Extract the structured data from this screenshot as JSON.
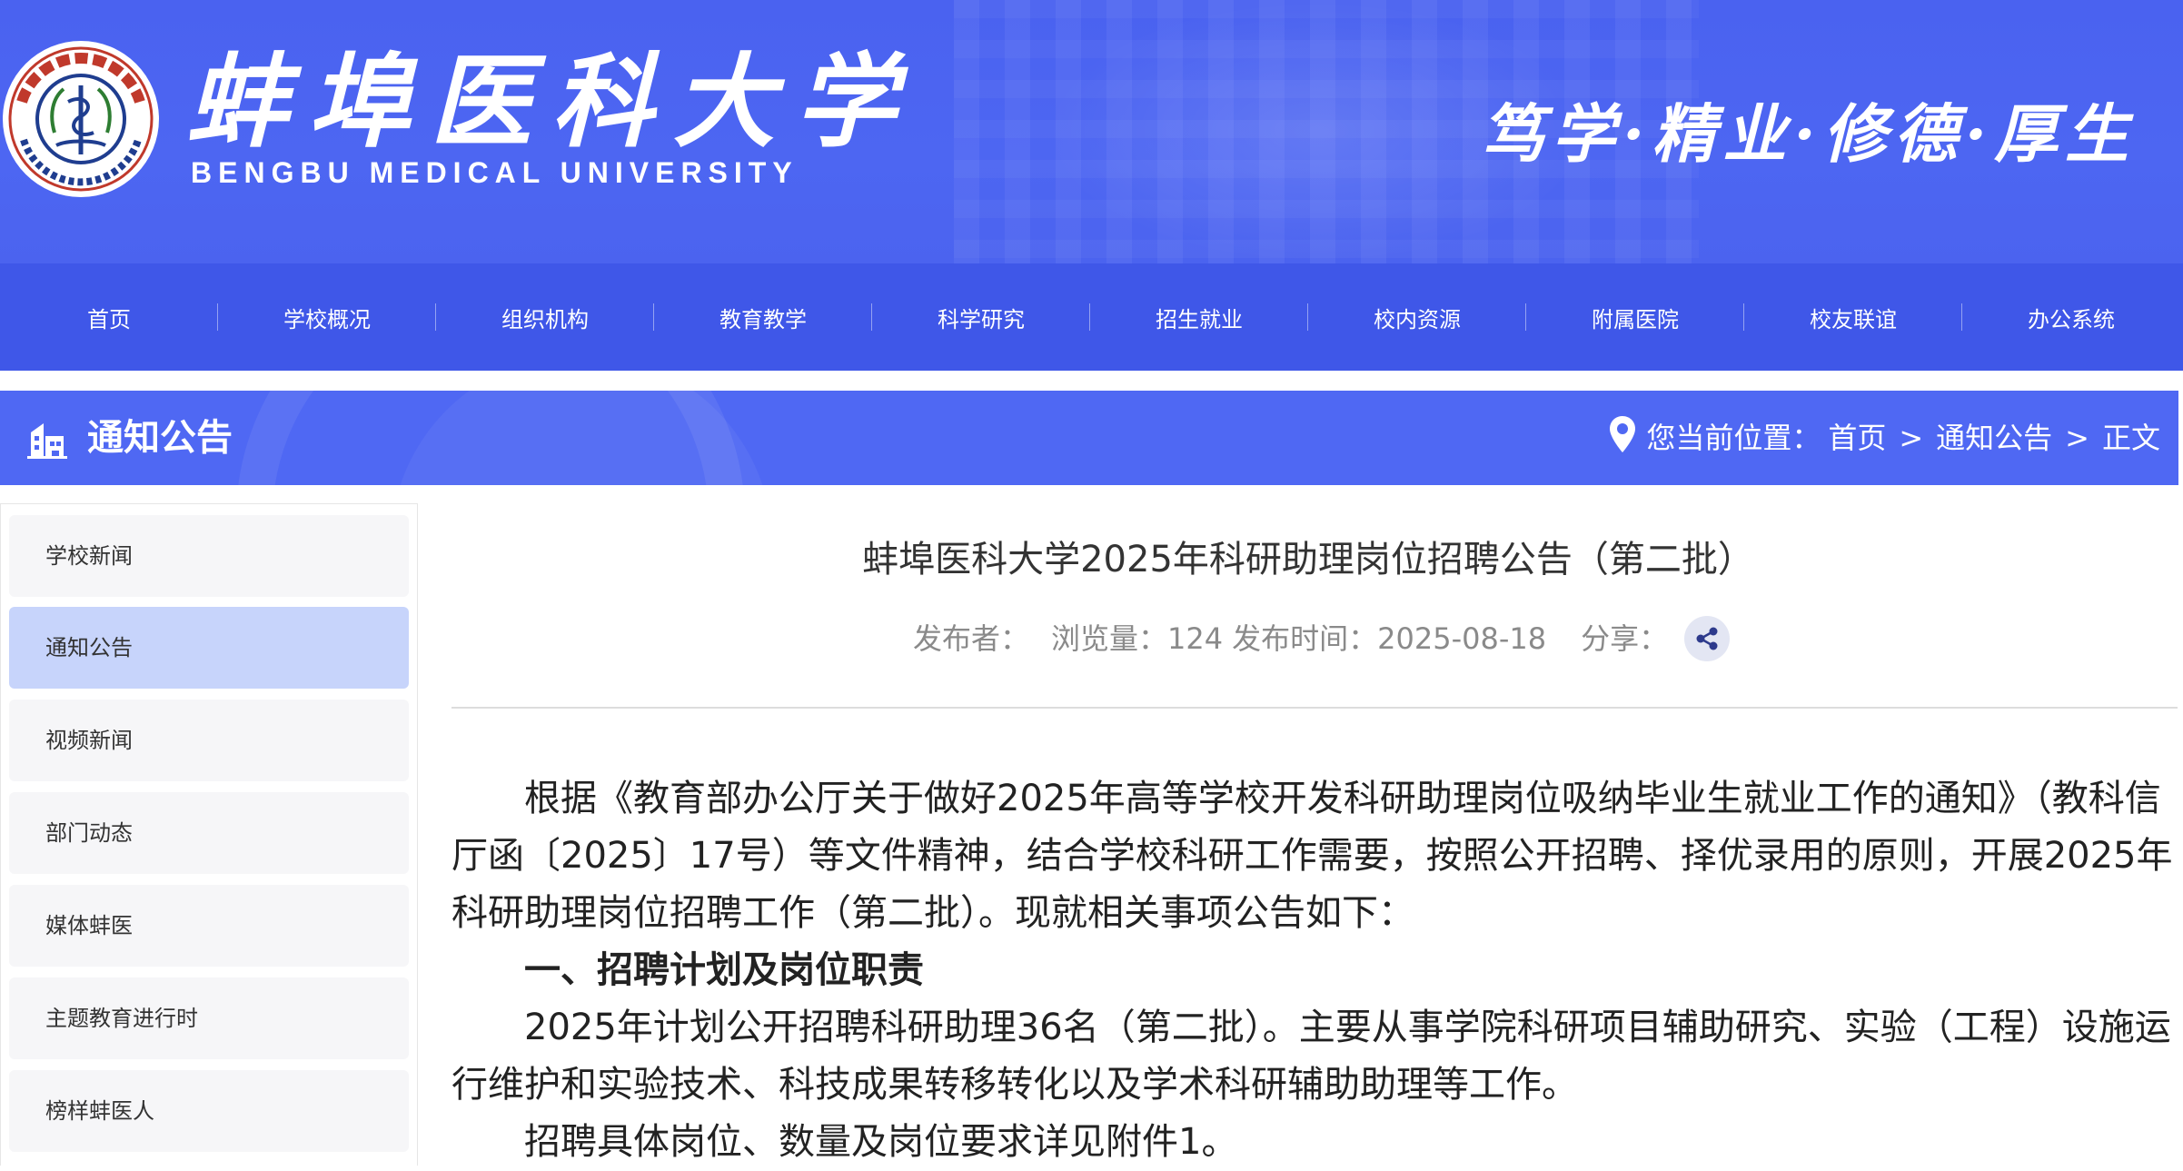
{
  "header": {
    "logo_cn": "蚌埠医科大学",
    "logo_en": "BENGBU MEDICAL UNIVERSITY",
    "motto": "笃学·精业·修德·厚生",
    "seal_text": "蚌埠医科大学 Bengbu Medical University 1958"
  },
  "nav": {
    "items": [
      "首页",
      "学校概况",
      "组织机构",
      "教育教学",
      "科学研究",
      "招生就业",
      "校内资源",
      "附属医院",
      "校友联谊",
      "办公系统"
    ]
  },
  "section": {
    "title": "通知公告",
    "location_label": "您当前位置：",
    "crumbs": [
      "首页",
      "通知公告",
      "正文"
    ],
    "sep": ">"
  },
  "sidebar": {
    "items": [
      "学校新闻",
      "通知公告",
      "视频新闻",
      "部门动态",
      "媒体蚌医",
      "主题教育进行时",
      "榜样蚌医人"
    ],
    "active_index": 1
  },
  "article": {
    "title": "蚌埠医科大学2025年科研助理岗位招聘公告（第二批）",
    "publisher_label": "发布者：",
    "views_label": "浏览量：",
    "views": "124",
    "date_label": "发布时间：",
    "date": "2025-08-18",
    "share_label": "分享：",
    "paragraphs": [
      "根据《教育部办公厅关于做好2025年高等学校开发科研助理岗位吸纳毕业生就业工作的通知》（教科信厅函〔2025〕17号）等文件精神，结合学校科研工作需要，按照公开招聘、择优录用的原则，开展2025年科研助理岗位招聘工作（第二批）。现就相关事项公告如下：",
      "一、招聘计划及岗位职责",
      "2025年计划公开招聘科研助理36名（第二批）。主要从事学院科研项目辅助研究、实验（工程）设施运行维护和实验技术、科技成果转移转化以及学术科研辅助助理等工作。",
      "招聘具体岗位、数量及岗位要求详见附件1。"
    ]
  },
  "colors": {
    "header_bg": "#4a62f0",
    "nav_bg": "#3f57e8",
    "section_bg": "#4f68f3",
    "sidebar_active": "#c7d4fb"
  }
}
